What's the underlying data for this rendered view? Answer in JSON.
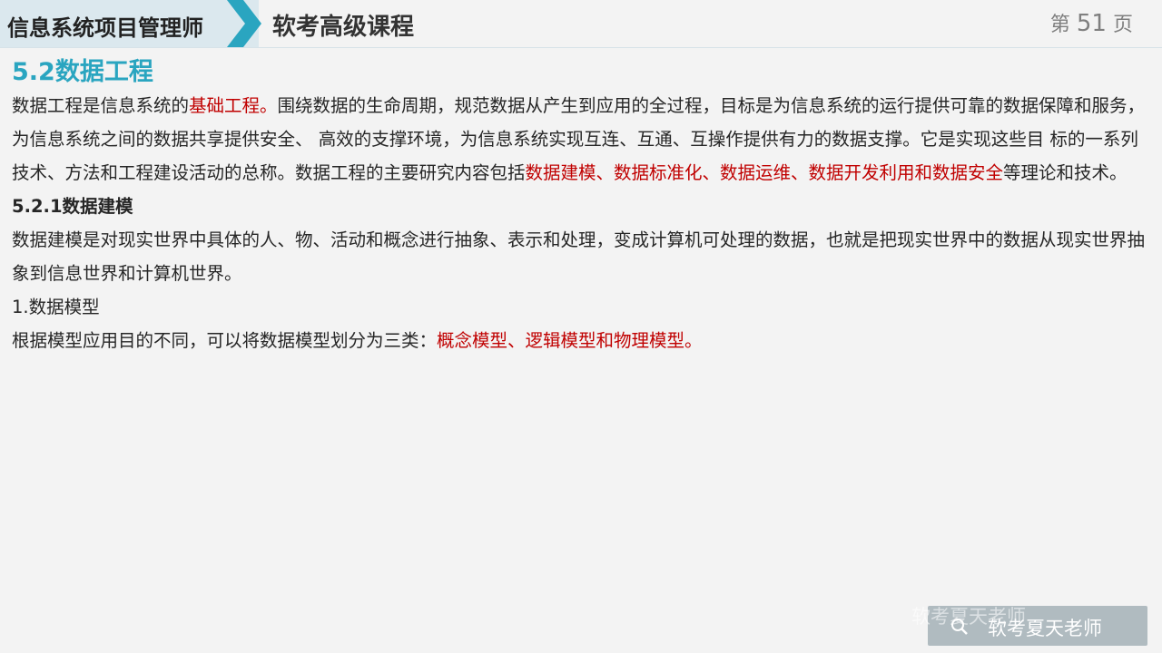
{
  "header": {
    "course_title": "信息系统项目管理师",
    "subtitle": "软考高级课程",
    "page_prefix": "第",
    "page_number": "51",
    "page_suffix": "页"
  },
  "content": {
    "section_title": "5.2数据工程",
    "p1": {
      "t1": "数据工程是信息系统的",
      "h1": "基础工程。",
      "t2": "围绕数据的生命周期，规范数据从产生到应用的全过程，目标是为信息系统的运行提供可靠的数据",
      "t3": "保障和服务，为信息系统之间的数据共享提供安全、 高效的支撑环境，为信息系统实现互连、互通、互操作提供有力的数据支撑。它",
      "t4": "是实现这些目 标的一系列技术、方法和工程建设活动的总称。数据工程的主要研究内容包括",
      "h2": "数据建模、数据标准化、数据运维、数据",
      "h3": "开发利用和数据安全",
      "t5": "等理论和技术。"
    },
    "subsection_title": "5.2.1数据建模",
    "p2": {
      "line1": "数据建模是对现实世界中具体的人、物、活动和概念进行抽象、表示和处理，变成计算机可处理的数据，也就是把现实世界中的数据",
      "line2": "从现实世界抽象到信息世界和计算机世界。"
    },
    "item1": "1.数据模型",
    "p3": {
      "t1": "根据模型应用目的不同，可以将数据模型划分为三类：",
      "h1": "概念模型、逻辑模型和物理模型。"
    }
  },
  "watermark": {
    "ghost_text": "软考夏天老师",
    "text": "软考夏天老师",
    "icon": "search-icon"
  },
  "colors": {
    "accent": "#2aa5c0",
    "highlight": "#c00000",
    "header_band": "#dbe8ee",
    "chevron": "#2aa5c0"
  }
}
